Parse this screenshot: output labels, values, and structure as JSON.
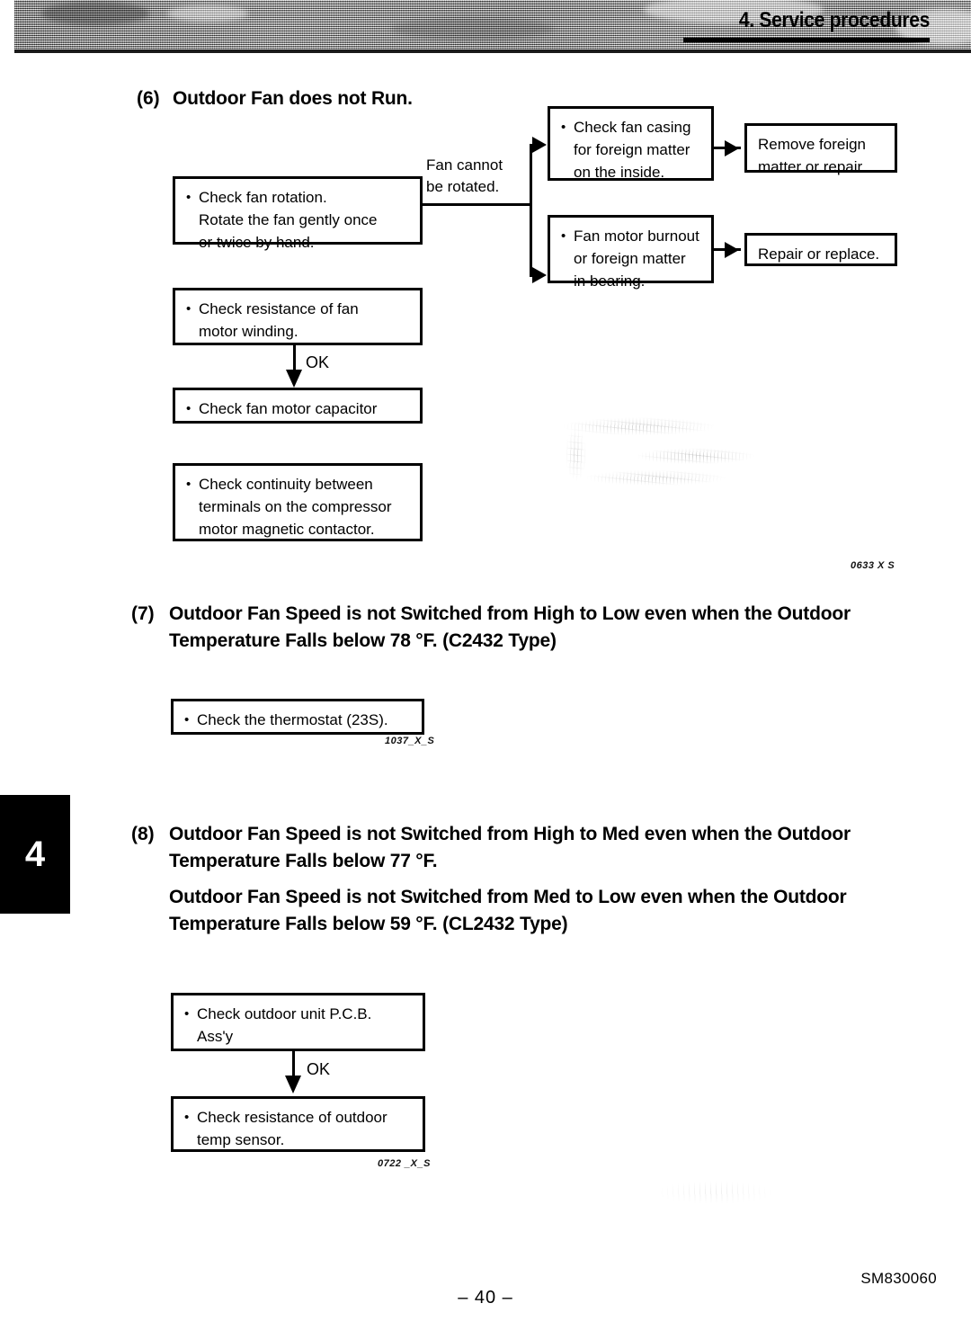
{
  "header": {
    "title": "4. Service procedures"
  },
  "chapter_tab": {
    "number": "4"
  },
  "sections": {
    "six": {
      "number": "(6)",
      "title": "Outdoor Fan does not Run.",
      "figure_code": "0633 X S",
      "branch_label": "Fan cannot\nbe rotated.",
      "ok_label": "OK",
      "boxes": {
        "check_rotation": "Check fan rotation.\nRotate the fan gently once\nor twice by hand.",
        "check_resistance": "Check resistance of fan\nmotor winding.",
        "check_capacitor": "Check fan motor capacitor",
        "check_continuity": "Check continuity between\nterminals on the compressor\nmotor magnetic contactor.",
        "check_casing": "Check fan casing\nfor foreign matter\non the inside.",
        "fan_motor_burnout": "Fan motor burnout\nor foreign matter\nin bearing.",
        "remove_foreign": "Remove foreign\nmatter or repair.",
        "repair_replace": "Repair or replace."
      }
    },
    "seven": {
      "number": "(7)",
      "title": "Outdoor Fan Speed is not Switched from High to Low even when the Outdoor\nTemperature Falls below 78 °F. (C2432 Type)",
      "figure_code": "1037_X_S",
      "boxes": {
        "check_thermostat": "Check the thermostat (23S)."
      }
    },
    "eight": {
      "number": "(8)",
      "title": "Outdoor Fan Speed is not Switched from High to Med even when the Outdoor\nTemperature Falls below 77 °F.",
      "title_second": "Outdoor Fan Speed is not Switched from Med to Low even when the Outdoor\nTemperature Falls below 59 °F. (CL2432 Type)",
      "figure_code": "0722 _X_S",
      "ok_label": "OK",
      "boxes": {
        "check_pcb": "Check outdoor unit P.C.B.\nAss'y",
        "check_sensor": "Check resistance of outdoor\ntemp sensor."
      }
    }
  },
  "footer": {
    "page_number": "– 40 –",
    "document_code": "SM830060"
  }
}
